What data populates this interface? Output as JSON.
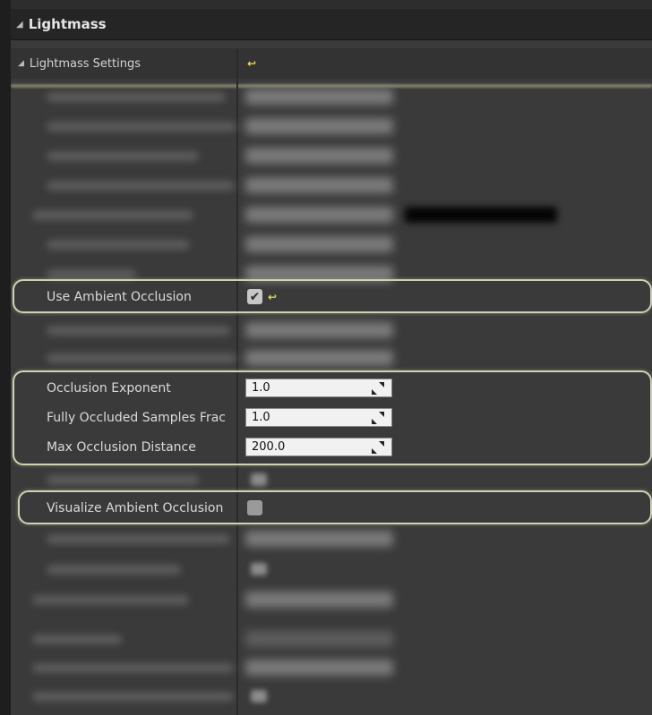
{
  "category": {
    "title": "Lightmass",
    "arrow": "◢"
  },
  "section": {
    "title": "Lightmass Settings",
    "arrow": "◢",
    "reset_symbol": "↩"
  },
  "ambient_occlusion": {
    "label": "Use Ambient Occlusion",
    "checked": true,
    "check_symbol": "✔",
    "reset_symbol": "↩"
  },
  "occlusion": [
    {
      "label": "Occlusion Exponent",
      "value": "1.0"
    },
    {
      "label": "Fully Occluded Samples Frac",
      "value": "1.0"
    },
    {
      "label": "Max Occlusion Distance",
      "value": "200.0"
    }
  ],
  "visualize": {
    "label": "Visualize Ambient Occlusion",
    "checked": false
  },
  "colors": {
    "panel_bg": "#3a3a3a",
    "header_bg": "#252525",
    "highlight_border": "#cfd3b3",
    "reset_icon": "#e6d94a"
  }
}
